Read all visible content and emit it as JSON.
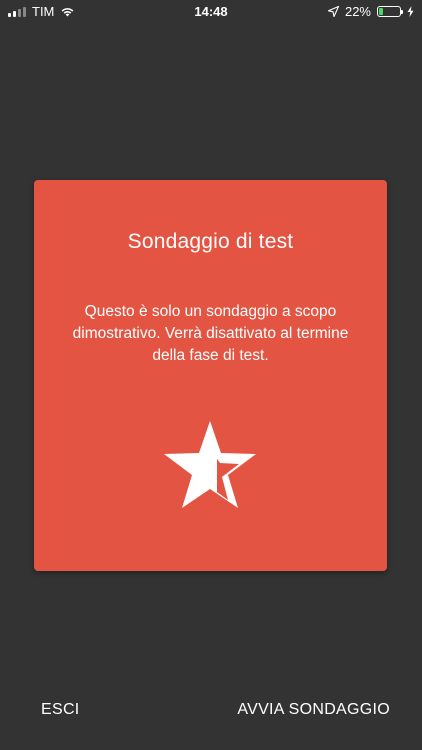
{
  "status_bar": {
    "carrier": "TIM",
    "time": "14:48",
    "battery_percent": "22%",
    "battery_level": 0.22,
    "icons": [
      "signal-icon",
      "wifi-icon",
      "location-arrow-icon",
      "battery-icon",
      "charging-bolt-icon"
    ]
  },
  "survey": {
    "title": "Sondaggio di test",
    "description": "Questo è solo un sondaggio a scopo dimostrativo. Verrà disattivato al termine della fase di test.",
    "icon": "star-icon",
    "card_color": "#e35443"
  },
  "footer": {
    "exit_label": "ESCI",
    "start_label": "AVVIA SONDAGGIO"
  },
  "colors": {
    "background": "#333333",
    "accent": "#e35443",
    "battery": "#4cd964"
  }
}
